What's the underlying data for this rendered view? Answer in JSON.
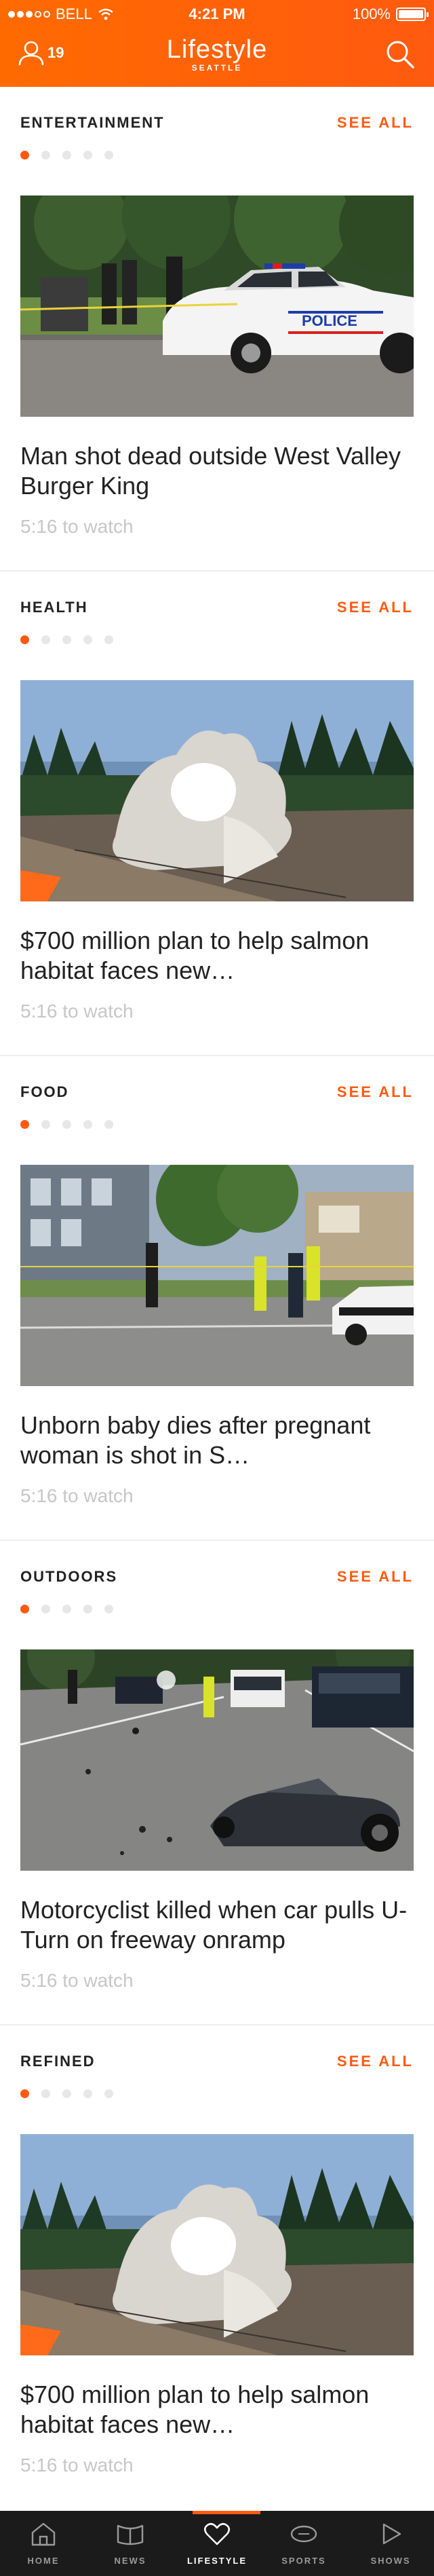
{
  "status": {
    "carrier": "BELL",
    "time": "4:21 PM",
    "battery": "100%",
    "battery_level": 1.0
  },
  "header": {
    "user_count": "19",
    "title": "Lifestyle",
    "subtitle": "SEATTLE"
  },
  "sections": [
    {
      "title": "ENTERTAINMENT",
      "see_all": "SEE ALL",
      "headline": "Man shot dead outside West Valley Burger King",
      "duration": "5:16 to watch",
      "active_dot": 0
    },
    {
      "title": "HEALTH",
      "see_all": "SEE ALL",
      "headline": "$700 million plan to help salmon habitat faces new…",
      "duration": "5:16 to watch",
      "active_dot": 0
    },
    {
      "title": "FOOD",
      "see_all": "SEE ALL",
      "headline": "Unborn baby dies after pregnant woman is shot in S…",
      "duration": "5:16 to watch",
      "active_dot": 0
    },
    {
      "title": "OUTDOORS",
      "see_all": "SEE ALL",
      "headline": "Motorcyclist killed when car pulls U-Turn on freeway onramp",
      "duration": "5:16 to watch",
      "active_dot": 0
    },
    {
      "title": "REFINED",
      "see_all": "SEE ALL",
      "headline": "$700 million plan to help salmon habitat faces new…",
      "duration": "5:16 to watch",
      "active_dot": 0
    }
  ],
  "tabs": [
    {
      "label": "HOME",
      "icon": "home-icon"
    },
    {
      "label": "NEWS",
      "icon": "news-icon"
    },
    {
      "label": "LIFESTYLE",
      "icon": "heart-icon",
      "active": true
    },
    {
      "label": "SPORTS",
      "icon": "ball-icon"
    },
    {
      "label": "SHOWS",
      "icon": "play-icon"
    }
  ],
  "colors": {
    "accent": "#ff5a10",
    "header": "#ff6a00",
    "tabbar": "#1b1b1b",
    "muted": "#c7c7c7"
  }
}
